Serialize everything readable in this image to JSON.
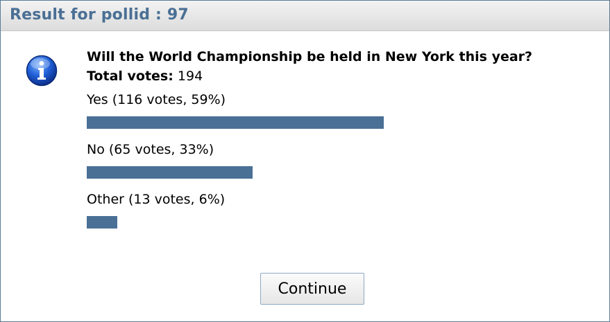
{
  "dialog": {
    "title": "Result for pollid : 97",
    "icon": "info-icon"
  },
  "poll": {
    "question": "Will the World Championship be held in New York this year?",
    "total_label": "Total votes:",
    "total_value": "194",
    "options": [
      {
        "label": "Yes (116 votes, 59%)",
        "votes": 116,
        "percent": 59
      },
      {
        "label": "No (65 votes, 33%)",
        "votes": 65,
        "percent": 33
      },
      {
        "label": "Other (13 votes, 6%)",
        "votes": 13,
        "percent": 6
      }
    ],
    "bar_color": "#4a7095"
  },
  "actions": {
    "continue_label": "Continue"
  }
}
